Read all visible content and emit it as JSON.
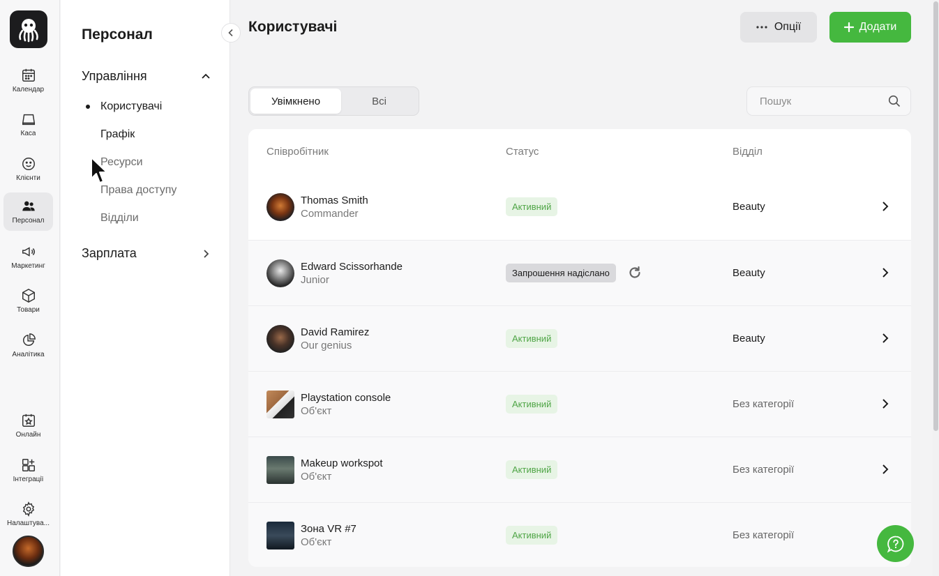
{
  "rail": {
    "items": [
      {
        "label": "Календар",
        "icon": "calendar-icon"
      },
      {
        "label": "Каса",
        "icon": "cash-register-icon"
      },
      {
        "label": "Клієнти",
        "icon": "smile-icon"
      },
      {
        "label": "Персонал",
        "icon": "people-icon"
      },
      {
        "label": "Маркетинг",
        "icon": "megaphone-icon"
      },
      {
        "label": "Товари",
        "icon": "box-icon"
      },
      {
        "label": "Аналітика",
        "icon": "pie-chart-icon"
      },
      {
        "label": "Онлайн",
        "icon": "star-calendar-icon"
      },
      {
        "label": "Інтеграції",
        "icon": "grid-plus-icon"
      },
      {
        "label": "Налаштува...",
        "icon": "gear-icon"
      }
    ],
    "active": "Персонал"
  },
  "menu": {
    "title": "Персонал",
    "group_management": "Управління",
    "sub_items": [
      "Користувачі",
      "Графік",
      "Ресурси",
      "Права доступу",
      "Відділи"
    ],
    "group_salary": "Зарплата"
  },
  "header": {
    "title": "Користувачі",
    "options_label": "Опції",
    "add_label": "Додати"
  },
  "tabs": {
    "enabled": "Увімкнено",
    "all": "Всі"
  },
  "search": {
    "placeholder": "Пошук"
  },
  "table": {
    "columns": {
      "employee": "Співробітник",
      "status": "Статус",
      "department": "Відділ"
    },
    "rows": [
      {
        "name": "Thomas Smith",
        "role": "Commander",
        "status": "Активний",
        "department": "Beauty"
      },
      {
        "name": "Edward Scissorhande",
        "role": "Junior",
        "status": "Запрошення надіслано",
        "department": "Beauty"
      },
      {
        "name": "David Ramirez",
        "role": "Our genius",
        "status": "Активний",
        "department": "Beauty"
      },
      {
        "name": "Playstation console",
        "role": "Об'єкт",
        "status": "Активний",
        "department": "Без категорії"
      },
      {
        "name": "Makeup workspot",
        "role": "Об'єкт",
        "status": "Активний",
        "department": "Без категорії"
      },
      {
        "name": "Зона VR #7",
        "role": "Об'єкт",
        "status": "Активний",
        "department": "Без категорії"
      }
    ]
  },
  "colors": {
    "accent": "#45b83f",
    "active_badge_bg": "#e7f4e5",
    "active_badge_text": "#4fa546",
    "invite_badge_bg": "#d9d9dc"
  }
}
